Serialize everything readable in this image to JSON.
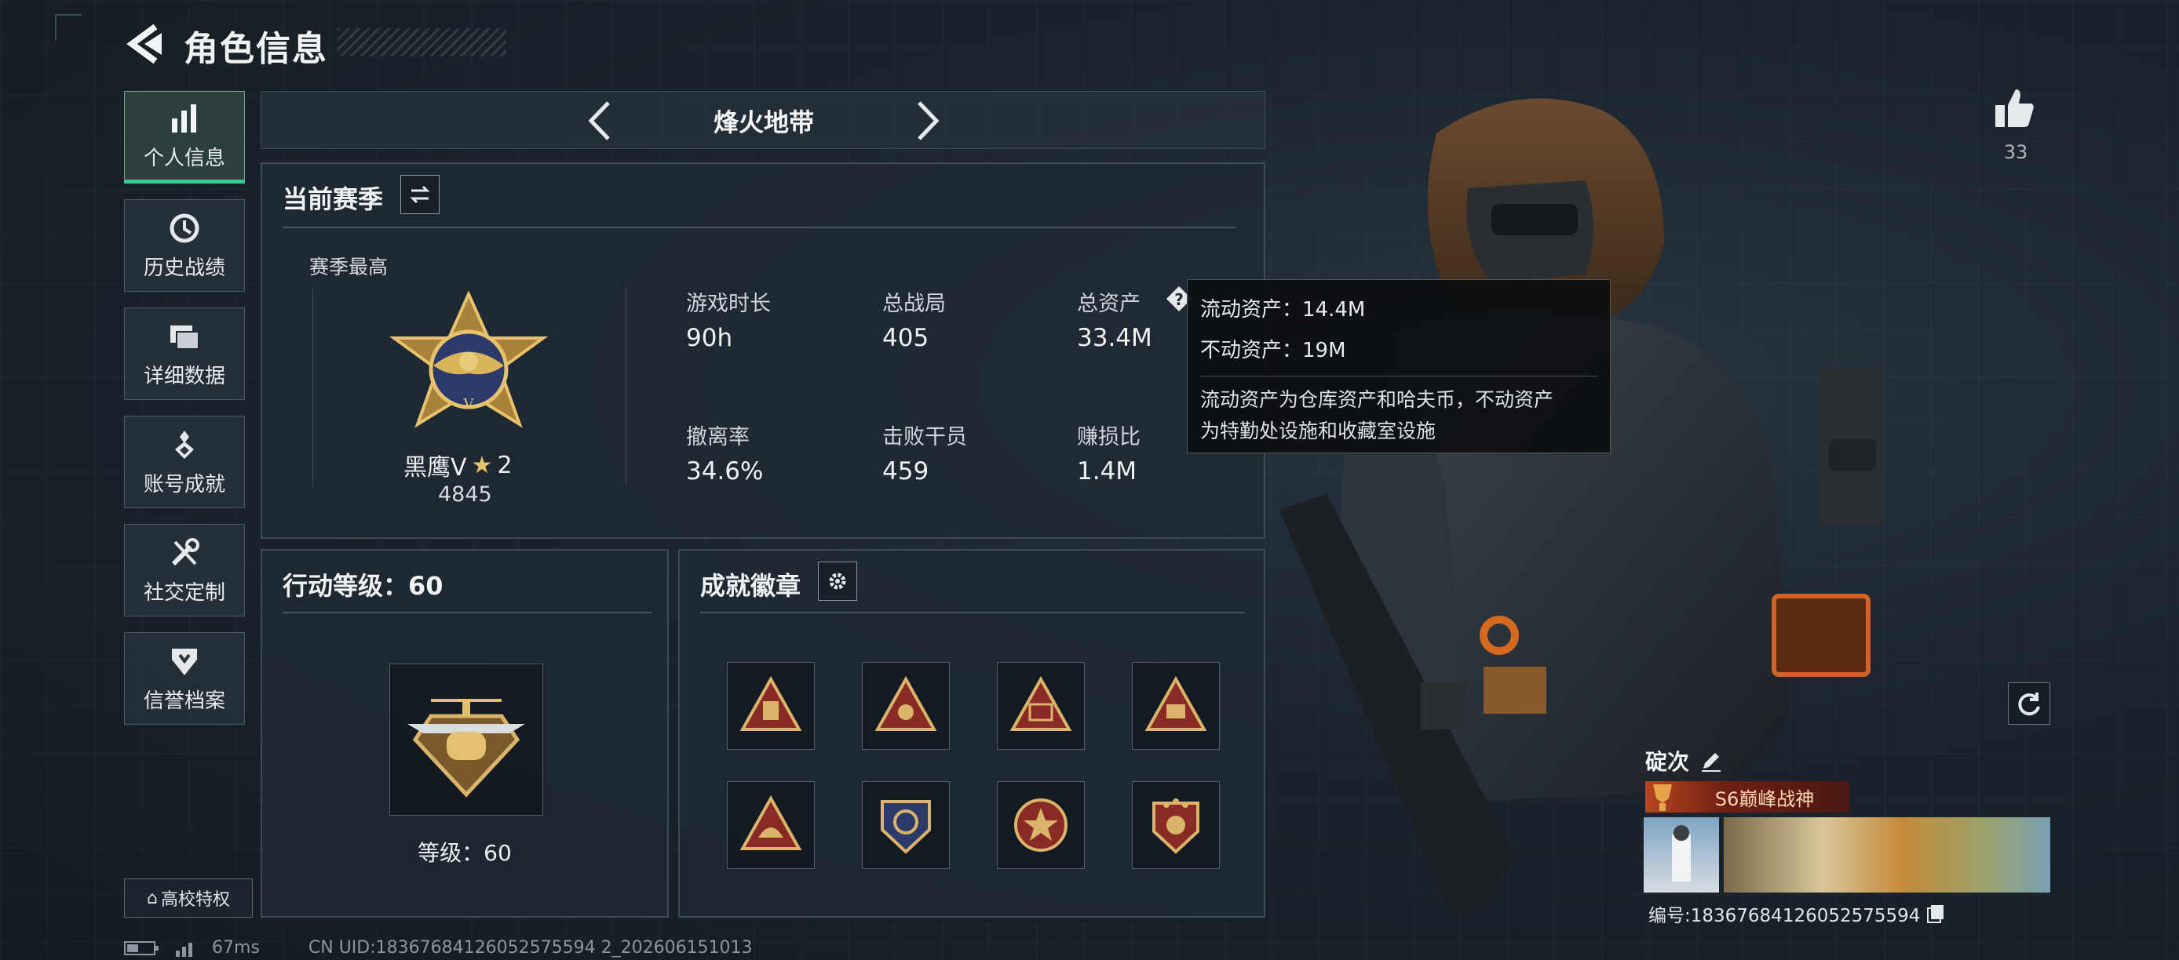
{
  "header": {
    "title": "角色信息"
  },
  "sidebar": {
    "items": [
      {
        "label": "个人信息",
        "icon": "bar-chart-icon",
        "active": true
      },
      {
        "label": "历史战绩",
        "icon": "clock-icon"
      },
      {
        "label": "详细数据",
        "icon": "folder-icon"
      },
      {
        "label": "账号成就",
        "icon": "medal-icon"
      },
      {
        "label": "社交定制",
        "icon": "wrench-icon"
      },
      {
        "label": "信誉档案",
        "icon": "shield-icon"
      }
    ],
    "campus_label": "高校特权"
  },
  "mode_bar": {
    "title": "烽火地带"
  },
  "season": {
    "header": "当前赛季",
    "best_label": "赛季最高",
    "rank_name": "黑鹰V",
    "rank_stars": "2",
    "rank_points": "4845",
    "stats": [
      {
        "label": "游戏时长",
        "value": "90h"
      },
      {
        "label": "总战局",
        "value": "405"
      },
      {
        "label": "总资产",
        "value": "33.4M"
      },
      {
        "label": "撤离率",
        "value": "34.6%"
      },
      {
        "label": "击败干员",
        "value": "459"
      },
      {
        "label": "赚损比",
        "value": "1.4M"
      }
    ]
  },
  "tooltip": {
    "liquid": "流动资产：14.4M",
    "fixed": "不动资产：19M",
    "desc_1": "流动资产为仓库资产和哈夫币，不动资产",
    "desc_2": "为特勤处设施和收藏室设施"
  },
  "action_level": {
    "header": "行动等级：60",
    "level_text": "等级：60"
  },
  "badges": {
    "header": "成就徽章",
    "count": 8
  },
  "likes": {
    "count": "33"
  },
  "player": {
    "name": "碇次",
    "title": "S6巅峰战神",
    "id_text": "编号:18367684126052575594"
  },
  "status": {
    "ping": "67ms",
    "uid": "CN UID:18367684126052575594 2_202606151013"
  },
  "colors": {
    "accent": "#3fc88f",
    "gold": "#c9a24a",
    "title_badge": "#8a2a1c"
  }
}
